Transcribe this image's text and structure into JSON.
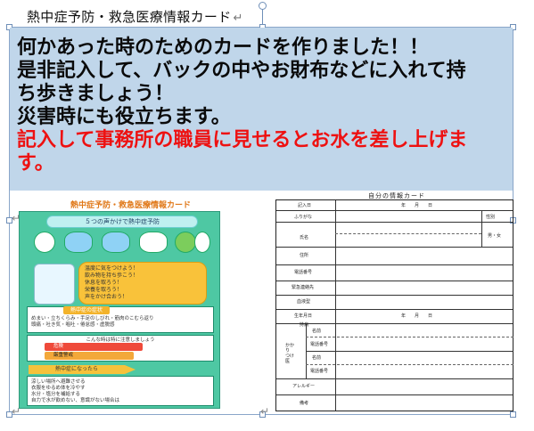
{
  "document": {
    "heading": "熱中症予防・救急医療情報カード",
    "return_mark": "↵"
  },
  "banner": {
    "lines": [
      "何かあった時のためのカードを作りました！！",
      "是非記入して、バックの中やお財布などに入れて持",
      "ち歩きましょう！",
      "災害時にも役立ちます。"
    ],
    "red_lines": [
      "記入して事務所の職員に見せるとお水を差し上げま",
      "す。"
    ],
    "colors": {
      "background": "#c0d6ea",
      "text": "#0a0a0a",
      "highlight": "#e11111"
    }
  },
  "left_card": {
    "title": "熱中症予防・救急医療情報カード",
    "pill": "５つの声かけで熱中症予防",
    "bubble_lines": [
      "温度に気をつけよう！",
      "飲み物を持ち歩こう！",
      "休息を取ろう！",
      "栄養を取ろう！",
      "声をかけ合おう！"
    ],
    "symptoms_header": "熱中症の症状",
    "symptoms_lines": [
      "めまい・立ちくらみ・手足のしびれ・筋肉のこむら返り",
      "頭痛・吐き気・嘔吐・倦怠感・虚脱感",
      "意識障害・けいれん・手足の運動障害",
      "高体温"
    ],
    "caution_header": "こんな時は特に注意しましょう",
    "levels": [
      "危険",
      "厳重警戒",
      "警戒"
    ],
    "arrow_label": "熱中症になったら",
    "firstaid_lines": [
      "涼しい場所へ避難させる",
      "衣服をゆるめ体を冷やす",
      "水分・塩分を補給する",
      "自力で水が飲めない、意識がない場合は",
      "すぐに救急車を呼びましょう"
    ]
  },
  "right_form": {
    "title": "自分の情報カード",
    "rows": [
      {
        "label": "記入日",
        "value": "年　　月　　日"
      },
      {
        "label": "ふりがな",
        "value": ""
      },
      {
        "label": "氏名",
        "value": ""
      },
      {
        "label": "住所",
        "value": ""
      },
      {
        "label": "電話番号",
        "value": ""
      },
      {
        "label": "緊急連絡先",
        "value": ""
      },
      {
        "label": "血液型",
        "value": ""
      },
      {
        "label": "生年月日",
        "value": "年　　月　　日"
      },
      {
        "label": "持病",
        "value": ""
      },
      {
        "label": "かかりつけ医",
        "value": ""
      },
      {
        "label": "アレルギー",
        "value": ""
      },
      {
        "label": "備考",
        "value": ""
      }
    ],
    "gender_label": "性別",
    "gender_value": "男・女",
    "doctor_sub": [
      "名前",
      "電話番号",
      "名前",
      "電話番号"
    ]
  }
}
